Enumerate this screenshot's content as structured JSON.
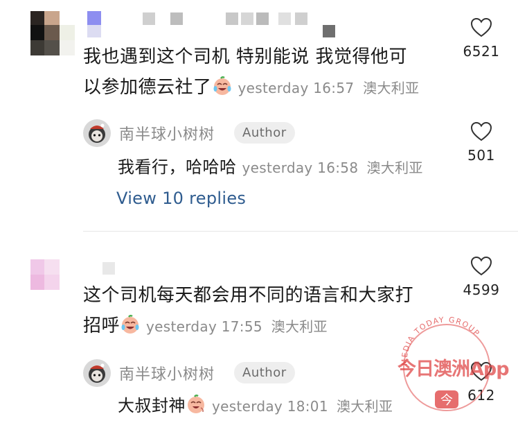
{
  "comments": [
    {
      "text_line1": "我也遇到这个司机 特别能说 我觉得他可",
      "text_line2": "以参加德云社了",
      "emoji": "crying-laughing-face-icon",
      "time": "yesterday 16:57",
      "location": "澳大利亚",
      "likes": "6521",
      "reply": {
        "username": "南半球小树树",
        "badge": "Author",
        "text": "我看行，哈哈哈",
        "time": "yesterday 16:58",
        "location": "澳大利亚",
        "likes": "501"
      },
      "view_replies": "View 10 replies"
    },
    {
      "text_line1": "这个司机每天都会用不同的语言和大家打",
      "text_line2": "招呼",
      "emoji": "crying-laughing-face-icon",
      "time": "yesterday 17:55",
      "location": "澳大利亚",
      "likes": "4599",
      "reply": {
        "username": "南半球小树树",
        "badge": "Author",
        "text": "大叔封神",
        "time": "yesterday 18:01",
        "location": "澳大利亚",
        "likes": "612"
      }
    }
  ],
  "watermark": {
    "arc_text": "MEDIA TODAY GROUP",
    "brand": "今日澳洲App",
    "logo_glyph": "今"
  },
  "colors": {
    "link": "#2f5c8f",
    "meta": "#8a8a8a",
    "watermark": "#e04848"
  }
}
